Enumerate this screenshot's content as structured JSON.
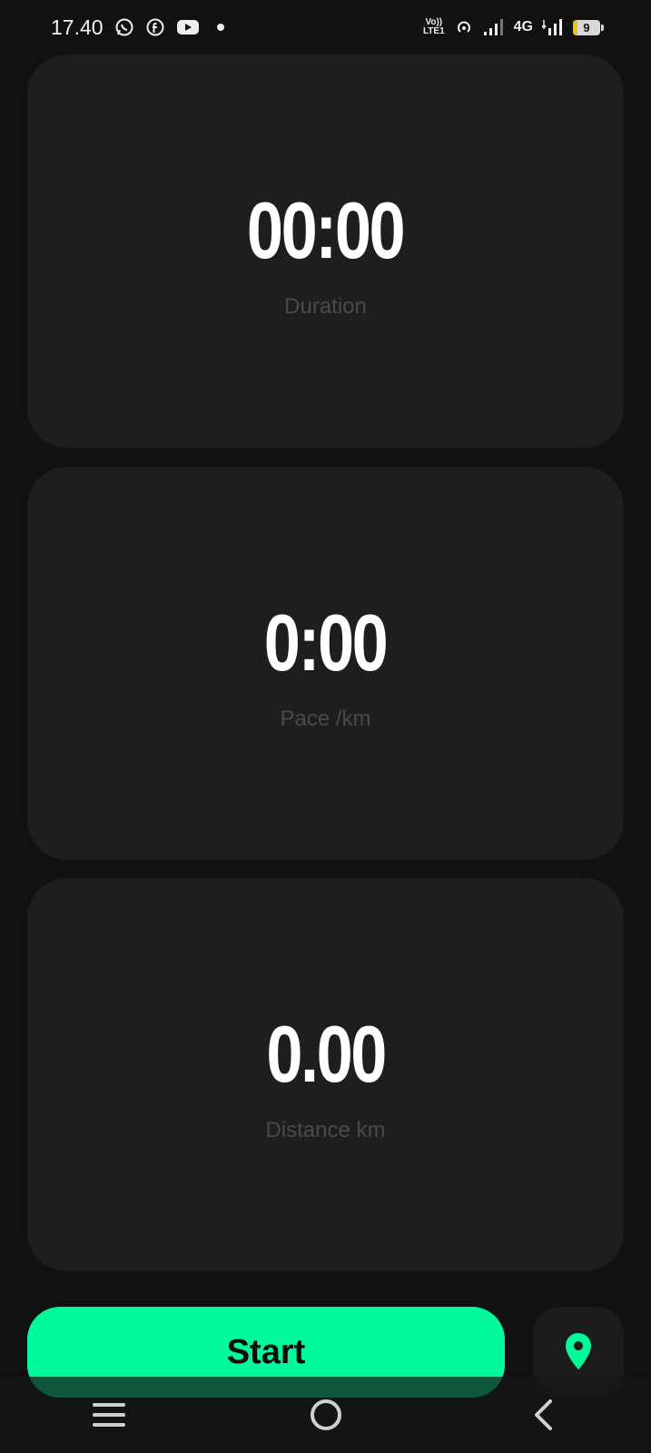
{
  "status_bar": {
    "time": "17.40",
    "volte_line1": "Vo))",
    "volte_line2": "LTE1",
    "network": "4G",
    "battery": "9",
    "icons": [
      "whatsapp-icon",
      "facebook-icon",
      "youtube-icon",
      "dot-icon",
      "hotspot-icon",
      "signal-icon",
      "signal-icon"
    ]
  },
  "cards": {
    "duration": {
      "value": "00:00",
      "label": "Duration"
    },
    "pace": {
      "value": "0:00",
      "label": "Pace /km"
    },
    "distance": {
      "value": "0.00",
      "label": "Distance km"
    }
  },
  "actions": {
    "start_label": "Start",
    "location_icon": "location-pin-icon"
  },
  "colors": {
    "accent": "#00f99b",
    "background": "#111111",
    "card": "#1e1e1e",
    "label": "#4a4a4a"
  },
  "nav_bar": {
    "icons": [
      "menu-icon",
      "home-icon",
      "back-icon"
    ]
  }
}
